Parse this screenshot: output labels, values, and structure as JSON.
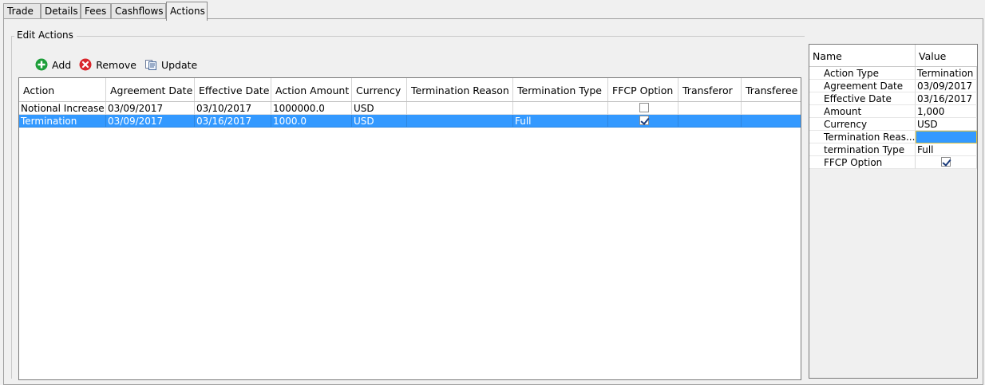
{
  "tabs": [
    {
      "label": "Trade",
      "active": false
    },
    {
      "label": "Details",
      "active": false
    },
    {
      "label": "Fees",
      "active": false
    },
    {
      "label": "Cashflows",
      "active": false
    },
    {
      "label": "Actions",
      "active": true
    }
  ],
  "section_title": "Edit Actions",
  "toolbar": {
    "add_label": "Add",
    "remove_label": "Remove",
    "update_label": "Update"
  },
  "grid": {
    "columns": [
      "Action",
      "Agreement Date",
      "Effective Date",
      "Action Amount",
      "Currency",
      "Termination Reason",
      "Termination Type",
      "FFCP Option",
      "Transferor",
      "Transferee"
    ],
    "rows": [
      {
        "selected": false,
        "cells": [
          "Notional Increase",
          "03/09/2017",
          "03/10/2017",
          "1000000.0",
          "USD",
          "",
          "",
          "",
          "",
          " "
        ],
        "ffcp": false
      },
      {
        "selected": true,
        "cells": [
          "Termination",
          "03/09/2017",
          "03/16/2017",
          "1000.0",
          "USD",
          "",
          "Full",
          "",
          "",
          " "
        ],
        "ffcp": true
      }
    ]
  },
  "props": {
    "headers": [
      "Name",
      "Value"
    ],
    "rows": [
      {
        "name": "Action Type",
        "value": "Termination"
      },
      {
        "name": "Agreement Date",
        "value": "03/09/2017"
      },
      {
        "name": "Effective Date",
        "value": "03/16/2017"
      },
      {
        "name": "Amount",
        "value": "1,000"
      },
      {
        "name": "Currency",
        "value": "USD"
      },
      {
        "name": "Termination Reas...",
        "value": "",
        "editing": true
      },
      {
        "name": "termination Type",
        "value": "Full"
      },
      {
        "name": "FFCP Option",
        "value": "",
        "checkbox": true
      }
    ]
  },
  "colors": {
    "selection": "#3399ff",
    "add_icon": "#1e9e3a",
    "remove_icon": "#d9262c"
  },
  "icons": {
    "add": "plus-circle-icon",
    "remove": "x-circle-icon",
    "update": "document-update-icon"
  }
}
